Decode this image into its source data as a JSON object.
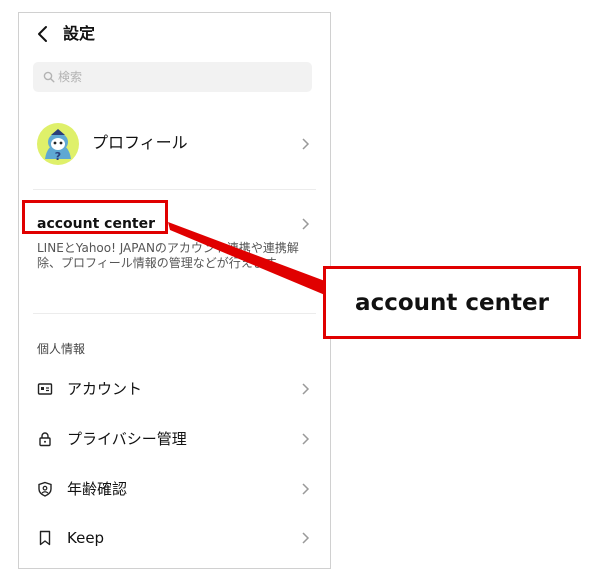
{
  "header": {
    "title": "設定"
  },
  "search": {
    "placeholder": "検索"
  },
  "profile": {
    "label": "プロフィール"
  },
  "account_center": {
    "title": "account center",
    "description": "LINEとYahoo! JAPANのアカウント連携や連携解除、プロフィール情報の管理などが行えます。"
  },
  "personal_info": {
    "section_label": "個人情報",
    "items": [
      {
        "label": "アカウント",
        "icon": "id-card-icon"
      },
      {
        "label": "プライバシー管理",
        "icon": "lock-icon"
      },
      {
        "label": "年齢確認",
        "icon": "shield-check-icon"
      },
      {
        "label": "Keep",
        "icon": "bookmark-icon"
      }
    ]
  },
  "annotation": {
    "callout_text": "account center",
    "accent_color": "#e00000"
  }
}
